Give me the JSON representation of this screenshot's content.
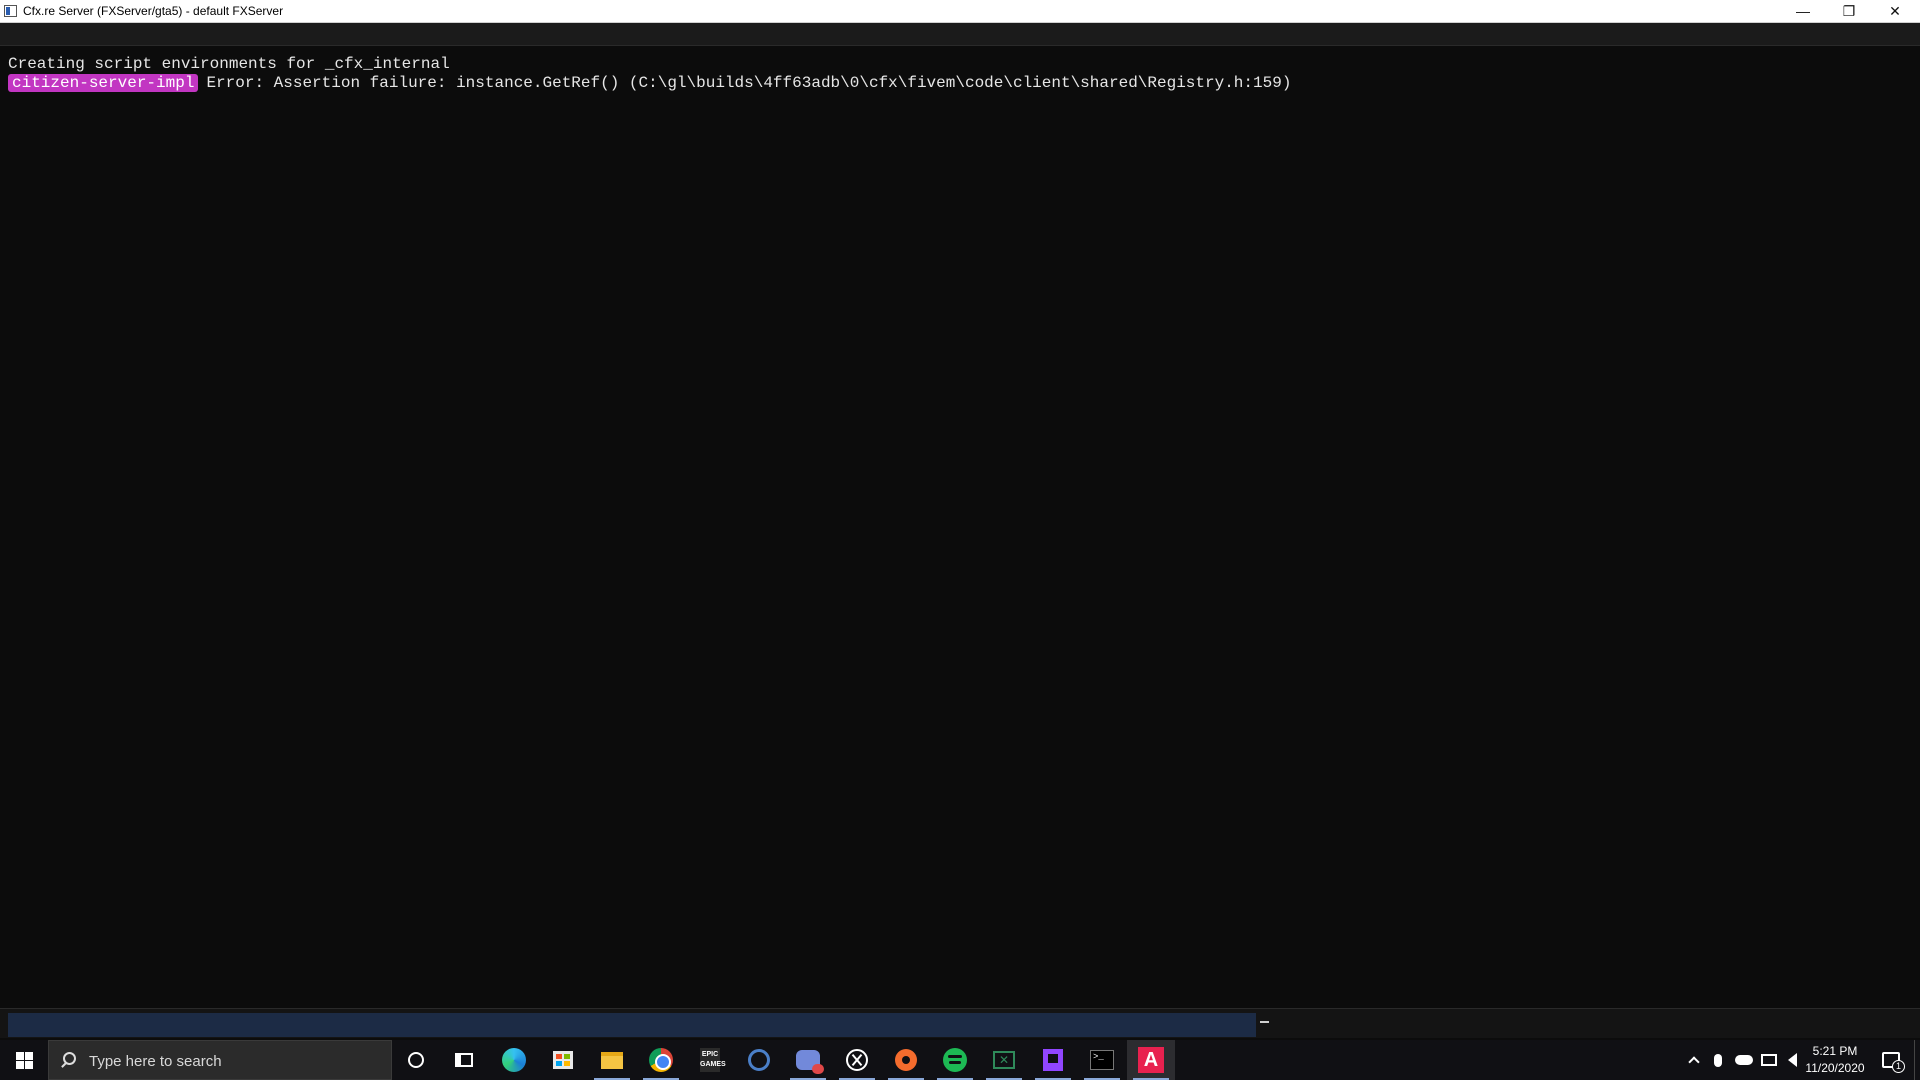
{
  "window": {
    "title": "Cfx.re Server (FXServer/gta5) - default FXServer",
    "controls": {
      "minimize": "—",
      "restore": "❐",
      "close": "✕"
    }
  },
  "console": {
    "line1": "Creating script environments for _cfx_internal",
    "line2_tag": "citizen-server-impl",
    "line2_message": "Error: Assertion failure: instance.GetRef() (C:\\gl\\builds\\4ff63adb\\0\\cfx\\fivem\\code\\client\\shared\\Registry.h:159)",
    "input_value": "",
    "cursor": "_"
  },
  "colors": {
    "console_bg": "#0c0c0c",
    "tag_bg": "#c236c2",
    "inputbar": "#1c2b45"
  },
  "taskbar": {
    "search_placeholder": "Type here to search",
    "pinned": [
      "cortana-icon",
      "task-view-icon",
      "edge-icon",
      "microsoft-store-icon",
      "file-explorer-icon",
      "chrome-icon",
      "epic-games-icon",
      "steam-icon",
      "discord-icon",
      "xbox-icon",
      "origin-icon",
      "spotify-icon",
      "xbox-game-bar-icon",
      "twitch-icon",
      "terminal-icon",
      "fxserver-icon"
    ],
    "epic_label": "EPIC GAMES",
    "clock_time": "5:21 PM",
    "clock_date": "11/20/2020",
    "notification_count": "1"
  }
}
